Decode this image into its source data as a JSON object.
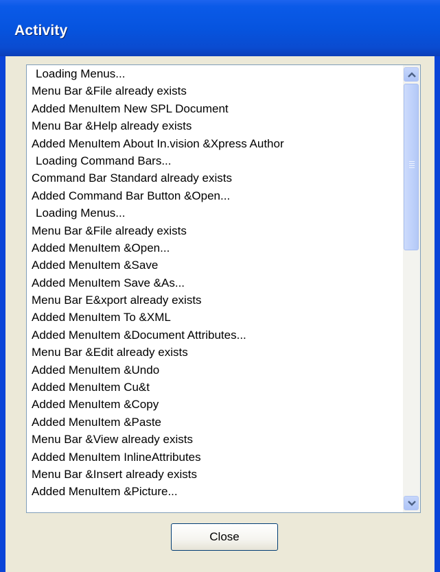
{
  "window": {
    "title": "Activity"
  },
  "activity_log": {
    "items": [
      " Loading Menus...",
      "Menu Bar &File already exists",
      "Added MenuItem New SPL Document",
      "Menu Bar &Help already exists",
      "Added MenuItem About In.vision &Xpress Author",
      " Loading Command Bars...",
      "Command Bar Standard already exists",
      "Added Command Bar Button &Open...",
      " Loading Menus...",
      "Menu Bar &File already exists",
      "Added MenuItem &Open...",
      "Added MenuItem &Save",
      "Added MenuItem Save &As...",
      "Menu Bar E&xport already exists",
      "Added MenuItem To &XML",
      "Added MenuItem &Document Attributes...",
      "Menu Bar &Edit already exists",
      "Added MenuItem &Undo",
      "Added MenuItem Cu&t",
      "Added MenuItem &Copy",
      "Added MenuItem &Paste",
      "Menu Bar &View already exists",
      "Added MenuItem InlineAttributes",
      "Menu Bar &Insert already exists",
      "Added MenuItem &Picture..."
    ]
  },
  "buttons": {
    "close_label": "Close"
  },
  "icons": {
    "scroll_up": "chevron-up-icon",
    "scroll_down": "chevron-down-icon"
  },
  "colors": {
    "titlebar": "#0654df",
    "dialog_bg": "#ece9d8",
    "scrollbar_accent": "#4d6185"
  }
}
